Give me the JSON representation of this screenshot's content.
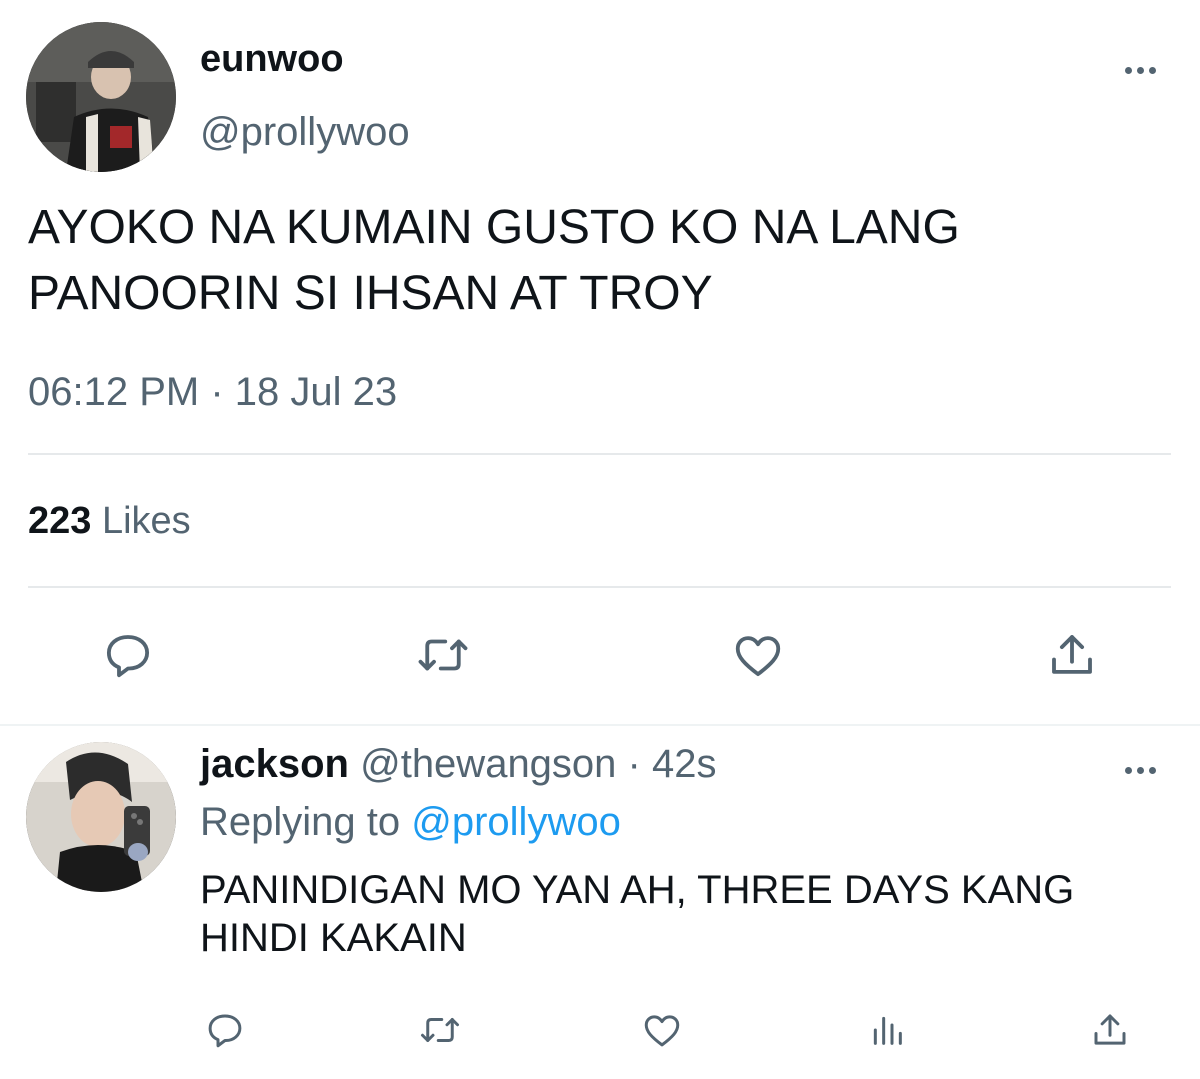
{
  "main_tweet": {
    "display_name": "eunwoo",
    "handle": "@prollywoo",
    "text_line1": "AYOKO NA KUMAIN GUSTO KO NA LANG",
    "text_line2": "PANOORIN SI IHSAN AT TROY",
    "timestamp": "06:12 PM · 18 Jul 23",
    "likes_count": "223",
    "likes_label": "Likes",
    "actions": [
      "reply-icon",
      "retweet-icon",
      "like-icon",
      "share-icon"
    ]
  },
  "reply_tweet": {
    "display_name": "jackson",
    "handle": "@thewangson",
    "separator": "·",
    "time": "42s",
    "replying_to_label": "Replying to",
    "replying_to_handle": "@prollywoo",
    "text_line1": "PANINDIGAN MO YAN AH, THREE DAYS KANG",
    "text_line2": "HINDI KAKAIN",
    "actions": [
      "reply-icon",
      "retweet-icon",
      "like-icon",
      "analytics-icon",
      "share-icon"
    ]
  },
  "colors": {
    "text_primary": "#0f1419",
    "text_secondary": "#536471",
    "link": "#1d9bf0",
    "divider": "#e6e9eb"
  }
}
